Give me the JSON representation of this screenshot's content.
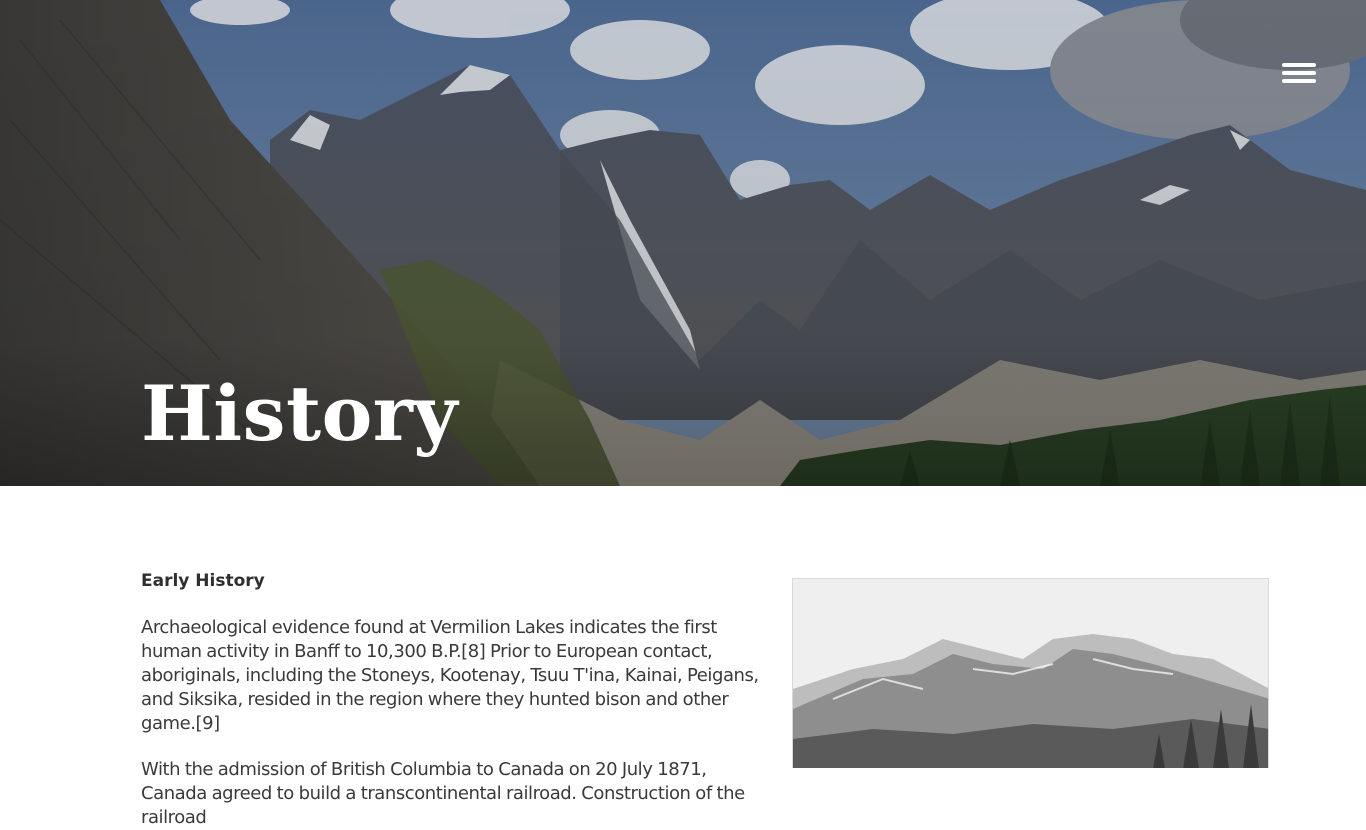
{
  "hero": {
    "title": "History",
    "menu_icon": "hamburger-menu-icon",
    "sky_color": "#6f8fb5",
    "forest_color": "#2d4a2a"
  },
  "content": {
    "section_heading": "Early History",
    "paragraphs": [
      "Archaeological evidence found at Vermilion Lakes indicates the first human activity in Banff to 10,300 B.P.[8] Prior to European contact, aboriginals, including the Stoneys, Kootenay, Tsuu T'ina, Kainai, Peigans, and Siksika, resided in the region where they hunted bison and other game.[9]",
      "With the admission of British Columbia to Canada on 20 July 1871, Canada agreed to build a transcontinental railroad. Construction of the railroad"
    ]
  },
  "photo": {
    "subject": "historic black-and-white mountain photograph"
  }
}
